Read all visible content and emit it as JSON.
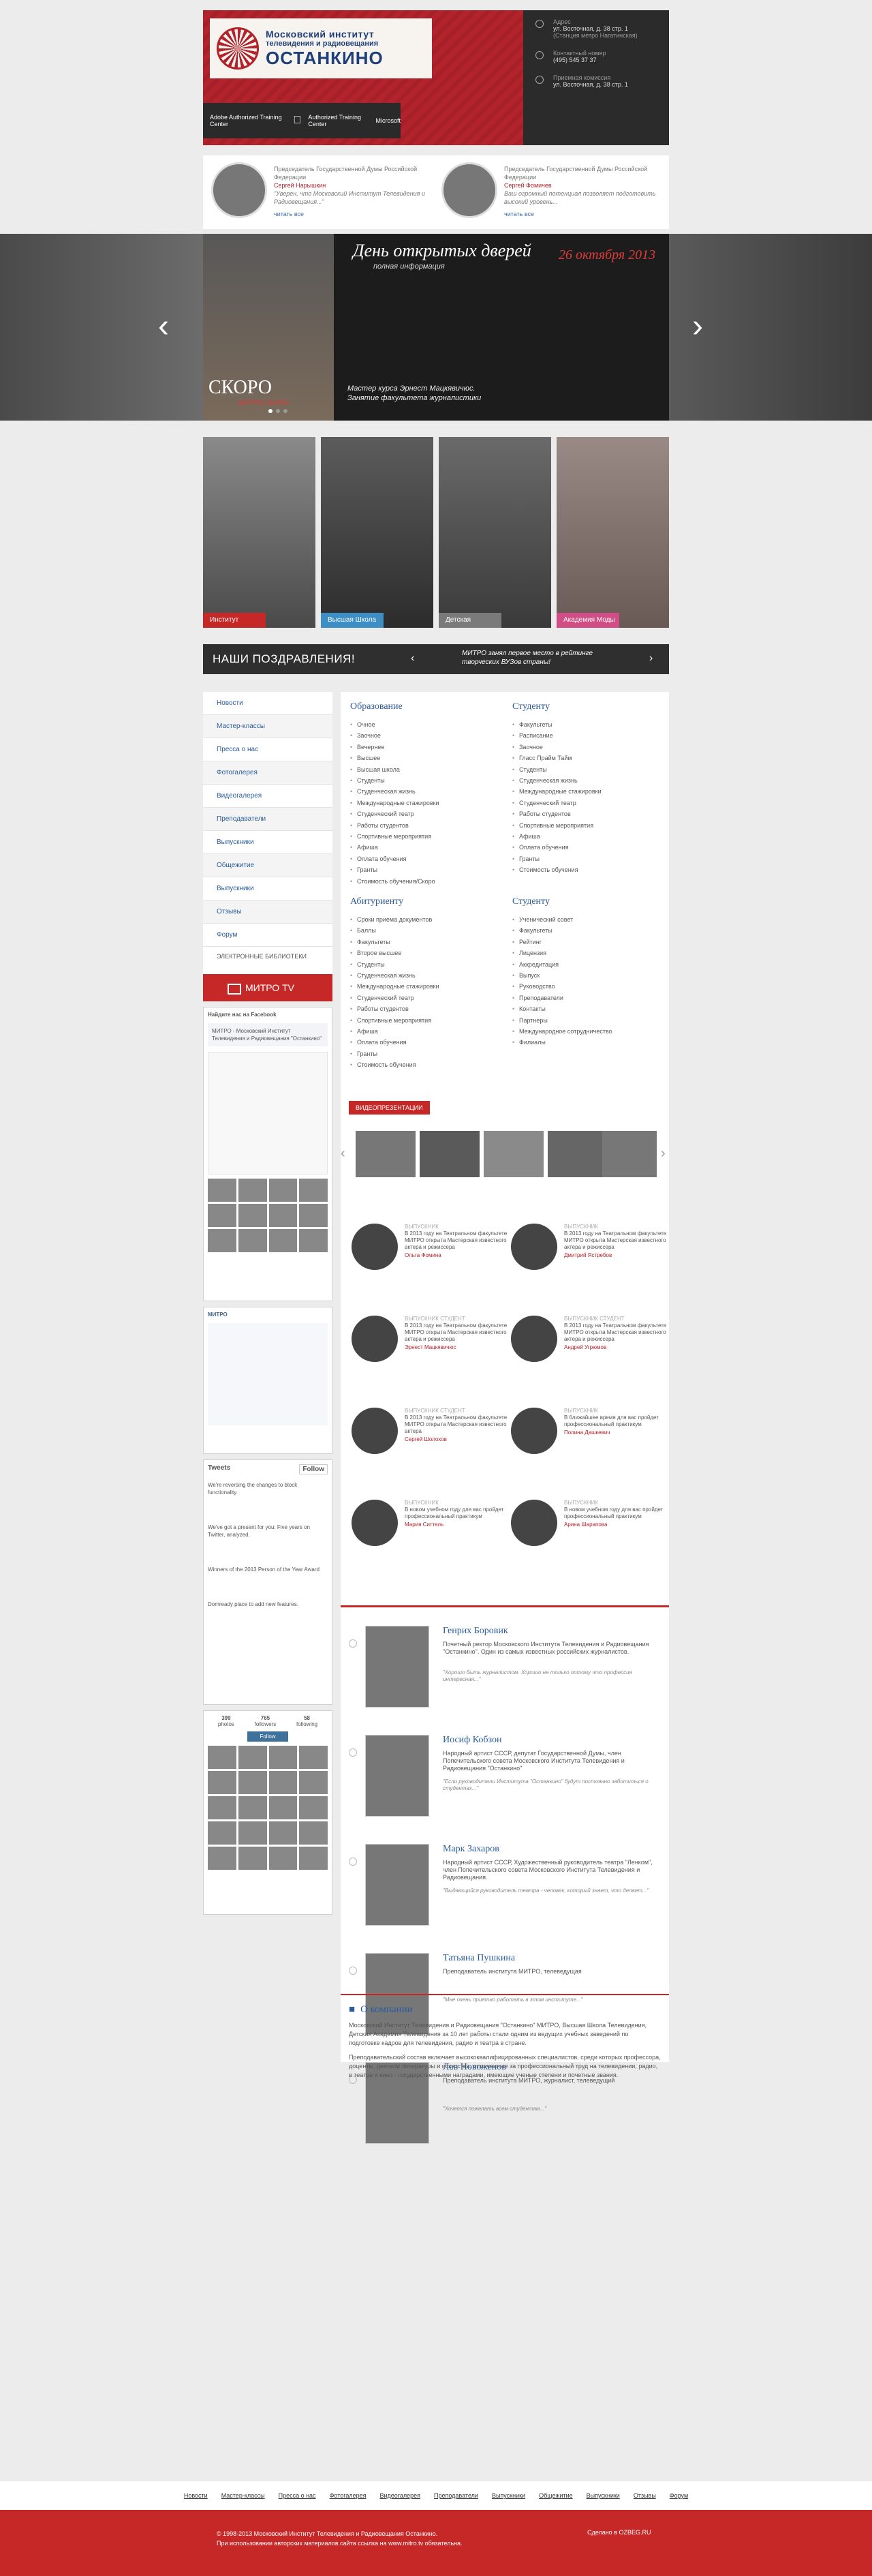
{
  "header": {
    "logo_line1": "Московский институт",
    "logo_line2": "телевидения и радиовещания",
    "logo_line3": "ОСТАНКИНО",
    "partners": [
      "Adobe Authorized Training Center",
      "",
      "Authorized Training Center",
      "Microsoft"
    ],
    "contacts": [
      {
        "label": "Адрес",
        "value": "ул. Восточная, д. 38 стр. 1",
        "extra": "(Станция метро Нагатинская)"
      },
      {
        "label": "Контактный номер",
        "value": "(495) 545 37 37",
        "extra": ""
      },
      {
        "label": "Приемная комиссия",
        "value": "ул. Восточная, д. 38 стр. 1",
        "extra": ""
      }
    ]
  },
  "quotes": [
    {
      "title": "Председатель Государственной Думы Российской Федерации",
      "name": "Сергей Нарышкин",
      "text": "\"Уверен, что Московский Институт Телевидения и Радиовещания...\"",
      "link": "читать все"
    },
    {
      "title": "Председатель Государственной Думы Российской Федерации",
      "name": "Сергей Фомичев",
      "text": "Ваш огромный потенциал позволяет подготовить высокий уровень...",
      "link": "читать все"
    }
  ],
  "hero": {
    "soon": "СКОРО",
    "soon_sub": "МИТРО СКОРО",
    "title": "День открытых дверей",
    "subtitle": "полная информация",
    "date": "26 октября 2013",
    "caption_line1": "Мастер курса Эрнест Мацкявичюс.",
    "caption_line2": "Занятие факультета журналистики"
  },
  "tiles": [
    "Институт",
    "Высшая Школа",
    "Детская Академия",
    "Академия Моды"
  ],
  "congrats": {
    "title": "НАШИ ПОЗДРАВЛЕНИЯ!",
    "message_line1": "МИТРО занял первое место в рейтинге",
    "message_line2": "творческих ВУЗов страны!"
  },
  "sidebar": {
    "nav": [
      "Новости",
      "Мастер-классы",
      "Пресса о нас",
      "Фотогалерея",
      "Видеогалерея",
      "Преподаватели",
      "Выпускники",
      "Общежитие",
      "Выпускники",
      "Отзывы",
      "Форум"
    ],
    "libraries": "ЭЛЕКТРОННЫЕ БИБЛИОТЕКИ",
    "mitro_tv": "МИТРО TV",
    "fb_title": "Найдите нас на Facebook",
    "fb_org": "МИТРО - Московский Институт Телевидения и Радиовещания \"Останкино\"",
    "vk_title": "МИТРО",
    "twitter_title": "Tweets",
    "twitter_follow": "Follow",
    "tweets": [
      "We're reversing the changes to block functionality.",
      "We've got a present for you: Five years on Twitter, analyzed.",
      "Winners of the 2013 Person of the Year Award",
      "Domready place to add new features."
    ],
    "ig_stats": [
      {
        "n": "399",
        "l": "photos"
      },
      {
        "n": "765",
        "l": "followers"
      },
      {
        "n": "58",
        "l": "following"
      }
    ],
    "ig_follow": "Follow"
  },
  "main": {
    "col1_title": "Образование",
    "col1": [
      "Очное",
      "Заочное",
      "Вечернее",
      "Высшее",
      "Высшая школа",
      "Студенты",
      "Студенческая жизнь",
      "Международные стажировки",
      "Студенческий театр",
      "Работы студентов",
      "Спортивные мероприятия",
      "Афиша",
      "Оплата обучения",
      "Гранты",
      "Стоимость обучения/Скоро"
    ],
    "col2_title": "Студенту",
    "col2": [
      "Факультеты",
      "Расписание",
      "Заочное",
      "Гласс Прайм Тайм",
      "Студенты",
      "Студенческая жизнь",
      "Международные стажировки",
      "Студенческий театр",
      "Работы студентов",
      "Спортивные мероприятия",
      "Афиша",
      "Оплата обучения",
      "Гранты",
      "Стоимость обучения"
    ],
    "col3_title": "Абитуриенту",
    "col3": [
      "Сроки приема документов",
      "Баллы",
      "Факультеты",
      "Второе высшее",
      "Студенты",
      "Студенческая жизнь",
      "Международные стажировки",
      "Студенческий театр",
      "Работы студентов",
      "Спортивные мероприятия",
      "Афиша",
      "Оплата обучения",
      "Гранты",
      "Стоимость обучения"
    ],
    "col4_title": "Студенту",
    "col4": [
      "Ученический совет",
      "Факультеты",
      "Рейтинг",
      "Лицензия",
      "Аккредитация",
      "Выпуск",
      "Руководство",
      "Преподаватели",
      "Контакты",
      "Партнеры",
      "Международное сотрудничество",
      "Филиалы"
    ],
    "video_label": "ВИДЕОПРЕЗЕНТАЦИИ",
    "testimonials": [
      {
        "kind": "ВЫПУСКНИК",
        "text": "В 2013 году на Театральном факультете МИТРО открыта Мастерская известного актера и режиссера",
        "name": "Ольга Фомина"
      },
      {
        "kind": "ВЫПУСКНИК",
        "text": "В 2013 году на Театральном факультете МИТРО открыта Мастерская известного актера и режиссера",
        "name": "Дмитрий Ястребов"
      },
      {
        "kind": "ВЫПУСКНИК СТУДЕНТ",
        "text": "В 2013 году на Театральном факультете МИТРО открыта Мастерская известного актера и режиссера",
        "name": "Эрнест Мацкявичюс"
      },
      {
        "kind": "ВЫПУСКНИК СТУДЕНТ",
        "text": "В 2013 году на Театральном факультете МИТРО открыта Мастерская известного актера и режиссера",
        "name": "Андрей Угрюмов"
      },
      {
        "kind": "ВЫПУСКНИК СТУДЕНТ",
        "text": "В 2013 году на Театральном факультете МИТРО открыта Мастерская известного актера",
        "name": "Сергей Шолохов"
      },
      {
        "kind": "ВЫПУСКНИК",
        "text": "В ближайшее время для вас пройдет профессиональный практикум",
        "name": "Полина Дашкевич"
      },
      {
        "kind": "ВЫПУСКНИК",
        "text": "В новом учебном году для вас пройдет профессиональный практикум",
        "name": "Мария Ситтель"
      },
      {
        "kind": "ВЫПУСКНИК",
        "text": "В новом учебном году для вас пройдет профессиональный практикум",
        "name": "Арина Шарапова"
      }
    ],
    "persons": [
      {
        "name": "Генрих Боровик",
        "role": "Почетный ректор Московского Института Телевидения и Радиовещания \"Останкино\". Один из самых известных российских журналистов.",
        "quote": "\"Хорошо быть журналистом. Хорошо не только потому что профессия интересная...\""
      },
      {
        "name": "Иосиф Кобзон",
        "role": "Народный артист СССР, депутат Государственной Думы, член Попечительского совета Московского Института Телевидения и Радиовещания \"Останкино\"",
        "quote": "\"Если руководители Института \"Останкино\" будут постоянно заботиться о студентах...\""
      },
      {
        "name": "Марк Захаров",
        "role": "Народный артист СССР, Художественный руководитель театра \"Ленком\", член Попечительского совета Московского Института Телевидения и Радиовещания.",
        "quote": "\"Выдающийся руководитель театра - человек, который знает, что делает...\""
      },
      {
        "name": "Татьяна Пушкина",
        "role": "Преподаватель института МИТРО, телеведущая",
        "quote": "\"Мне очень приятно работать в этом институте...\""
      },
      {
        "name": "Лев Новоженов",
        "role": "Преподаватель института МИТРО, журналист, телеведущий",
        "quote": "\"Хочется пожелать всем студентам...\""
      }
    ],
    "about_title": "О компании",
    "about_p1": "Московский Институт Телевидения и Радиовещания \"Останкино\" МИТРО, Высшая Школа Телевидения, Детская Академия Телевидения за 10 лет работы стали одним из ведущих учебных заведений по подготовке кадров для телевидения, радио и театра в стране.",
    "about_p2": "Преподавательский состав включает высококвалифицированных специалистов, среди которых профессора, доценты, деятели литературы и искусства, отмеченные за профессиональный труд на телевидении, радио, в театре и кино - государственными наградами, имеющие ученые степени и почетные звания."
  },
  "footer": {
    "nav": [
      "Новости",
      "Мастер-классы",
      "Пресса о нас",
      "Фотогалерея",
      "Видеогалерея",
      "Преподаватели",
      "Выпускники",
      "Общежитие",
      "Выпускники",
      "Отзывы",
      "Форум"
    ],
    "copyright": "© 1998-2013 Московский Институт Телевидения и Радиовещания Останкино.",
    "notice": "При использовании авторских материалов сайта ссылка на www.mitro.tv обязательна.",
    "made": "Сделано в OZBEG.RU"
  },
  "colors": {
    "accent": "#c62828",
    "link": "#2b5c9a",
    "dark": "#2f2f2f"
  }
}
